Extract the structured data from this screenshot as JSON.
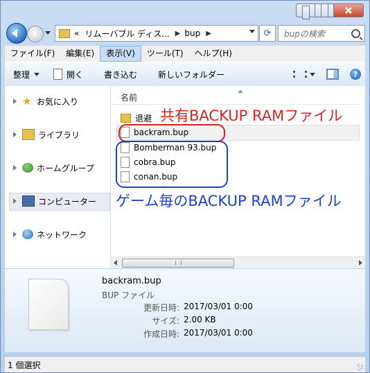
{
  "address": {
    "crumb_overflow": "«",
    "crumb1": "リムーバブル ディス...",
    "crumb2": "bup"
  },
  "search": {
    "placeholder": "bupの検索"
  },
  "menu": [
    "ファイル(F)",
    "編集(E)",
    "表示(V)",
    "ツール(T)",
    "ヘルプ(H)"
  ],
  "toolbar": {
    "organize": "整理",
    "open": "開く",
    "burn": "書き込む",
    "new_folder": "新しいフォルダー"
  },
  "nav": [
    "お気に入り",
    "ライブラリ",
    "ホームグループ",
    "コンピューター",
    "ネットワーク"
  ],
  "column": {
    "name": "名前"
  },
  "files": [
    {
      "name": "退避",
      "type": "folder"
    },
    {
      "name": "backram.bup",
      "type": "file"
    },
    {
      "name": "Bomberman 93.bup",
      "type": "file"
    },
    {
      "name": "cobra.bup",
      "type": "file"
    },
    {
      "name": "conan.bup",
      "type": "file"
    }
  ],
  "annotations": {
    "shared": "共有BACKUP RAMファイル",
    "per_game": "ゲーム毎のBACKUP RAMファイル"
  },
  "details": {
    "name": "backram.bup",
    "type": "BUP ファイル",
    "modified_label": "更新日時:",
    "modified": "2017/03/01 0:00",
    "size_label": "サイズ:",
    "size": "2.00 KB",
    "created_label": "作成日時:",
    "created": "2017/03/01 0:00"
  },
  "status": "1 個選択",
  "colors": {
    "annotation_red": "#e02020",
    "annotation_blue": "#1c3fd6"
  }
}
